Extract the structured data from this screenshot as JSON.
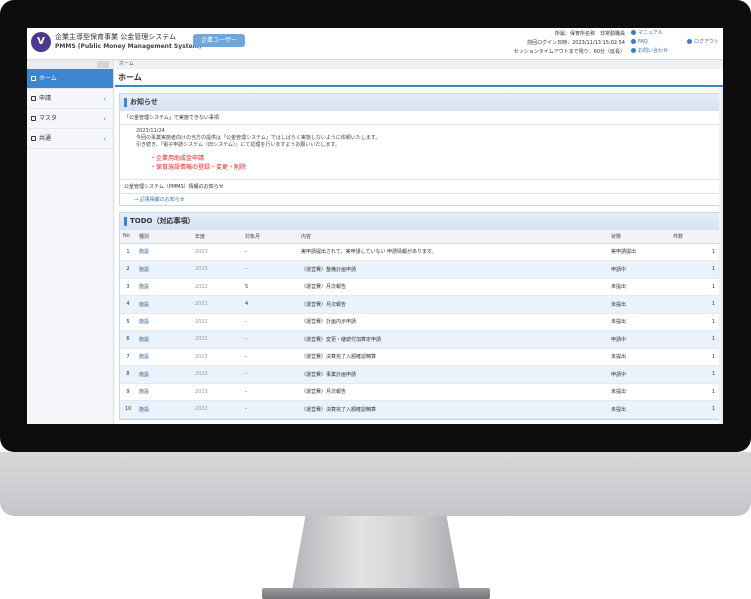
{
  "header": {
    "logo_glyph": "V",
    "system_title": "企業主導型保育事業 公金管理システム",
    "system_subtitle": "PMMS (Public Money Management System)",
    "user_badge": "企業ユーザー",
    "login_info": {
      "line1": "所属：保育所名称　非常勤職員",
      "line2": "前回ログイン日時：2023/11/13 15:02:54",
      "line3": "セッションタイムアウトまで残り：60分（延長）"
    },
    "links": [
      "マニュアル",
      "FAQ",
      "お問い合わせ"
    ],
    "logout_label": "ログアウト"
  },
  "sidebar": {
    "items": [
      {
        "label": "ホーム",
        "active": true,
        "has_chevron": false
      },
      {
        "label": "申請",
        "active": false,
        "has_chevron": true
      },
      {
        "label": "マスタ",
        "active": false,
        "has_chevron": true
      },
      {
        "label": "共通",
        "active": false,
        "has_chevron": true
      }
    ]
  },
  "main": {
    "breadcrumb": "ホーム",
    "page_title": "ホーム"
  },
  "notice": {
    "title": "お知らせ",
    "row1": "「公金管理システム」で実施できない事項",
    "date": "2023/11/24",
    "line1": "今回の事業実施者向けの当方の提供は「公金管理システム」ではしばらく実施しないように依頼いたします。",
    "line2": "引き続き、「電子申請システム（旧システム）」にて処理を行いますようお願いいたします。",
    "red1": "・企業用助成金申請",
    "red2": "・保育施設情報の登録・変更・削除",
    "row2": "公金管理システム（PMMS）情報のお知らせ",
    "link": "→ 記事掲載のお知らせ"
  },
  "todo": {
    "title": "TODO（対応事項）",
    "columns": [
      "No",
      "種別",
      "年度",
      "対象月",
      "内容",
      "状態",
      "件数"
    ],
    "rows": [
      {
        "no": "1",
        "type": "施設",
        "year": "2023",
        "month": "-",
        "content": "実申請提出されて、実申請していない 申請情報があります。",
        "status": "実申請提出",
        "count": "1"
      },
      {
        "no": "2",
        "type": "施設",
        "year": "2023",
        "month": "-",
        "content": "（運営費）整備計画申請",
        "status": "申請中",
        "count": "1"
      },
      {
        "no": "3",
        "type": "施設",
        "year": "2022",
        "month": "5",
        "content": "（運営費）月次報告",
        "status": "未提出",
        "count": "1"
      },
      {
        "no": "4",
        "type": "施設",
        "year": "2022",
        "month": "4",
        "content": "（運営費）月次報告",
        "status": "未提出",
        "count": "1"
      },
      {
        "no": "5",
        "type": "施設",
        "year": "2022",
        "month": "-",
        "content": "（運営費）計画内示申請",
        "status": "未提出",
        "count": "1"
      },
      {
        "no": "6",
        "type": "施設",
        "year": "2022",
        "month": "-",
        "content": "（運営費）変更・継続付加算定申請",
        "status": "申請中",
        "count": "1"
      },
      {
        "no": "7",
        "type": "施設",
        "year": "2023",
        "month": "-",
        "content": "（運営費）決算完了入額確認精算",
        "status": "未提出",
        "count": "1"
      },
      {
        "no": "8",
        "type": "施設",
        "year": "2023",
        "month": "-",
        "content": "（運営費）事業計画申請",
        "status": "申請中",
        "count": "1"
      },
      {
        "no": "9",
        "type": "施設",
        "year": "2023",
        "month": "-",
        "content": "（運営費）月次報告",
        "status": "未提出",
        "count": "1"
      },
      {
        "no": "10",
        "type": "施設",
        "year": "2022",
        "month": "-",
        "content": "（運営費）決算完了入額確認精算",
        "status": "未提出",
        "count": "1"
      }
    ]
  },
  "colors": {
    "accent": "#3c86d0",
    "brand": "#4b3a8c",
    "alert": "#e02020",
    "bezel": "#0d0d0d"
  }
}
